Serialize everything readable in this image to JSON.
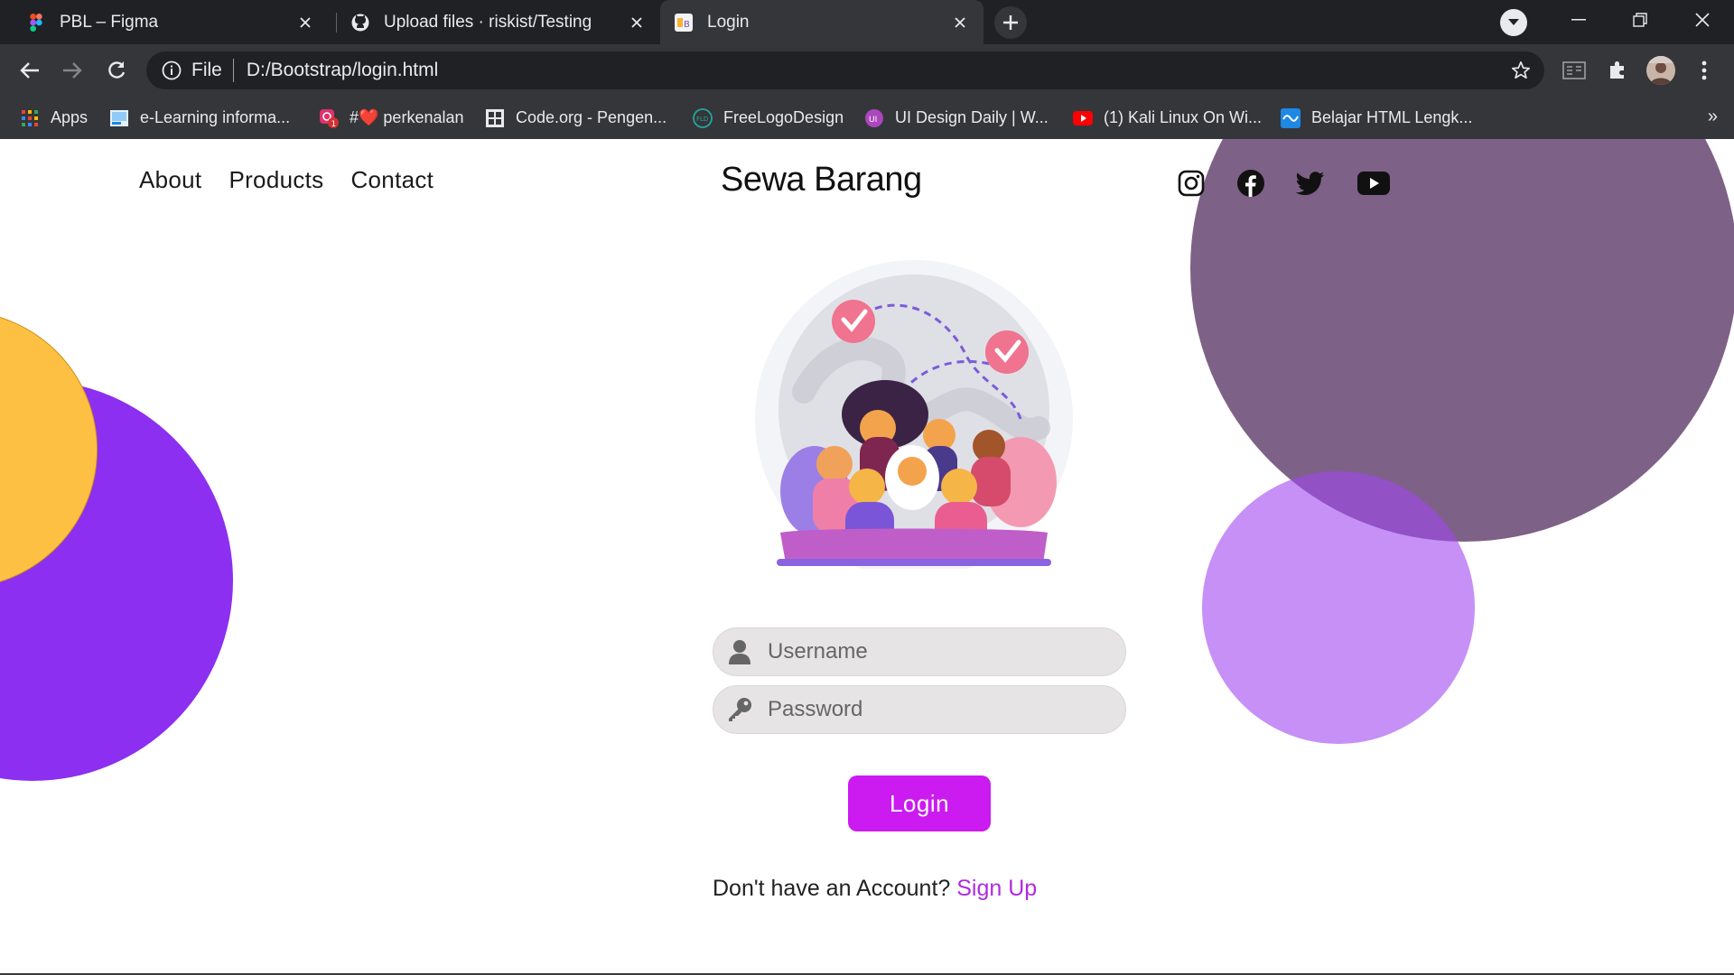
{
  "browser": {
    "tabs": [
      {
        "title": "PBL – Figma",
        "icon": "figma-icon"
      },
      {
        "title": "Upload files · riskist/Testing",
        "icon": "github-icon"
      },
      {
        "title": "Login",
        "icon": "bootstrap-icon",
        "active": true
      }
    ],
    "address": {
      "scheme": "File",
      "url": "D:/Bootstrap/login.html"
    },
    "bookmarks": [
      {
        "label": "Apps",
        "icon": "apps-grid-icon"
      },
      {
        "label": "e-Learning informa...",
        "icon": "elearning-icon"
      },
      {
        "label": "#❤️ perkenalan",
        "icon": "instagram-badge-icon"
      },
      {
        "label": "Code.org - Pengen...",
        "icon": "codeorg-icon"
      },
      {
        "label": "FreeLogoDesign",
        "icon": "freelogodesign-icon"
      },
      {
        "label": "UI Design Daily | W...",
        "icon": "uidesign-icon"
      },
      {
        "label": "(1) Kali Linux On Wi...",
        "icon": "youtube-icon"
      },
      {
        "label": "Belajar HTML Lengk...",
        "icon": "wave-icon"
      }
    ],
    "more_bookmarks": "»"
  },
  "page": {
    "nav": {
      "about": "About",
      "products": "Products",
      "contact": "Contact"
    },
    "brand": "Sewa Barang",
    "social_icons": [
      "instagram-icon",
      "facebook-icon",
      "twitter-icon",
      "youtube-icon"
    ],
    "form": {
      "username_placeholder": "Username",
      "password_placeholder": "Password",
      "login_label": "Login"
    },
    "signup": {
      "prompt": "Don't have an Account?",
      "link": "Sign Up"
    }
  },
  "colors": {
    "accent": "#cc1bf0",
    "link": "#b02ae0",
    "circle_yellow": "#fec043",
    "circle_purple": "#8c2ff0",
    "circle_mauve": "#7e6186",
    "circle_lilac": "#a44af0"
  }
}
